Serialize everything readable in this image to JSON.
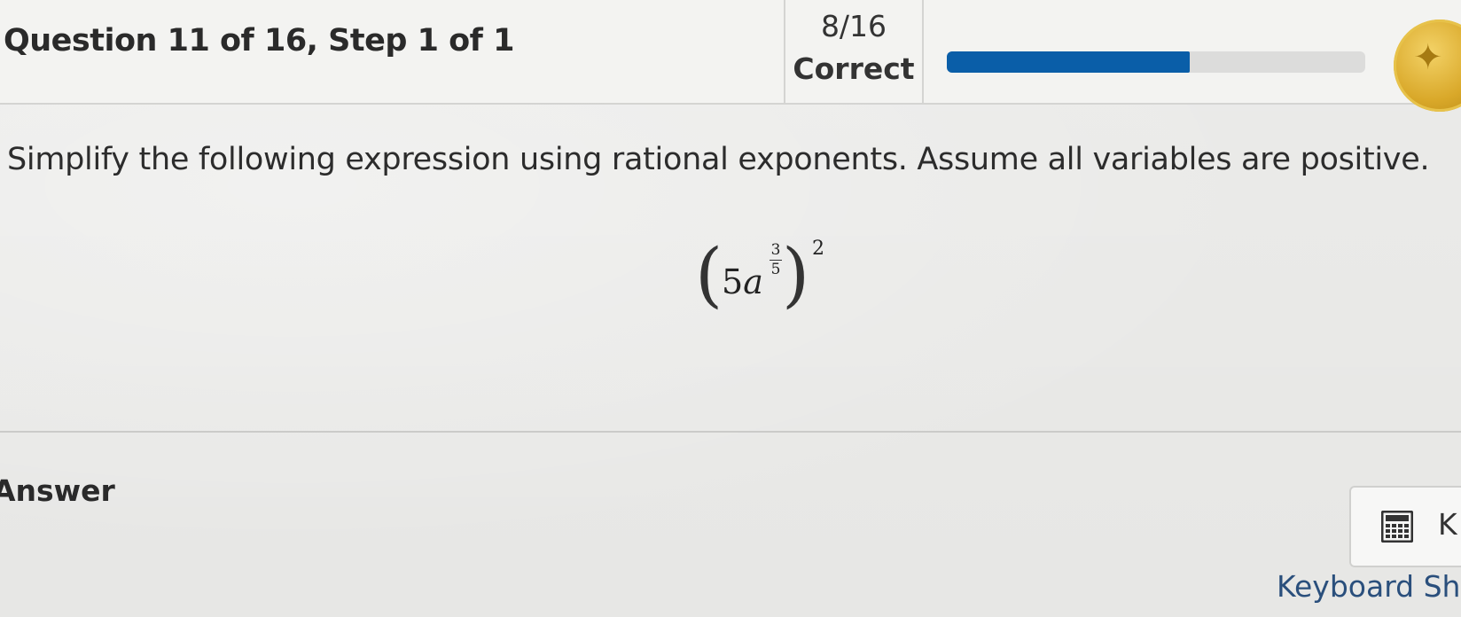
{
  "header": {
    "question_title": "Question 11 of 16, Step 1 of 1",
    "score_count": "8/16",
    "score_label": "Correct",
    "progress_fraction": 0.58,
    "colors": {
      "progress_fill": "#0a5ea8",
      "progress_track": "#dcdcdb",
      "medal": "#d9a829"
    },
    "medal_icon": "medal-icon"
  },
  "question": {
    "prompt": "Simplify the following expression using rational exponents. Assume all variables are positive.",
    "expression": {
      "coefficient": "5",
      "variable": "a",
      "inner_exponent_numerator": "3",
      "inner_exponent_denominator": "5",
      "outer_exponent": "2"
    }
  },
  "answer": {
    "label": "Answer",
    "keypad_button_letter": "K",
    "keypad_icon": "calculator-icon",
    "keyboard_shortcuts_link": "Keyboard Sh"
  }
}
